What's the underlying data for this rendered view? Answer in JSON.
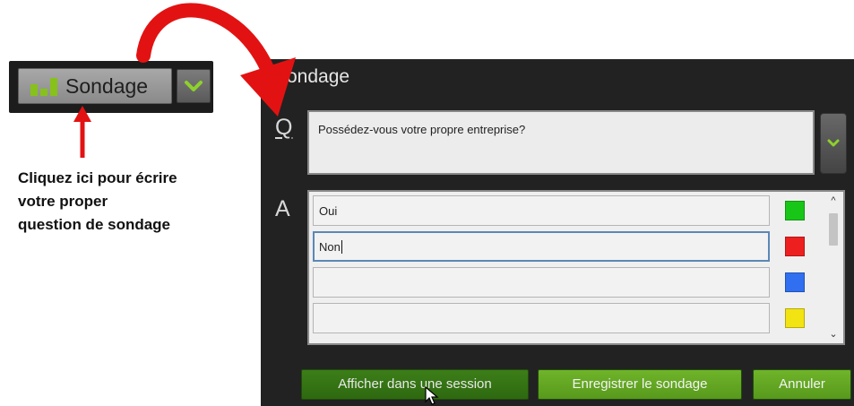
{
  "toolbar": {
    "poll_button_label": "Sondage",
    "bar_chart_icon": "bar-chart-icon",
    "dropdown_icon": "chevron-down-icon"
  },
  "annotation": {
    "text": "Cliquez ici pour écrire\nvotre proper\nquestion de sondage",
    "arrow_color": "#e31212"
  },
  "dialog": {
    "title": "Sondage",
    "question_marker": "Q",
    "answer_marker": "A",
    "question_text": "Possédez-vous votre propre entreprise?",
    "answers": [
      {
        "value": "Oui",
        "color": "#18c618"
      },
      {
        "value": "Non",
        "color": "#ee1f1f"
      },
      {
        "value": "",
        "color": "#2f6ff0"
      },
      {
        "value": "",
        "color": "#f2e312"
      }
    ],
    "buttons": {
      "show_in_session": "Afficher dans une session",
      "save_poll": "Enregistrer le sondage",
      "cancel": "Annuler"
    }
  },
  "colors": {
    "dialog_bg": "#222222",
    "accent_green": "#6fb42a",
    "dark_green": "#2e6910"
  }
}
